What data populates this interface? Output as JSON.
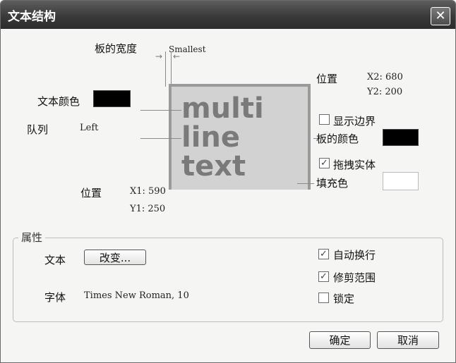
{
  "window": {
    "title": "文本结构",
    "close_glyph": "✕"
  },
  "top": {
    "panel_width_label": "板的宽度",
    "smallest": "Smallest",
    "text_color_label": "文本颜色",
    "align_label": "队列",
    "align_value": "Left",
    "pos1_label": "位置",
    "x1": "X1:  590",
    "y1": "Y1:  250",
    "pos2_label": "位置",
    "x2": "X2:  680",
    "y2": "Y2:  200",
    "show_border_label": "显示边界",
    "panel_color_label": "板的颜色",
    "drag_label": "拖拽实体",
    "fill_color_label": "填充色"
  },
  "preview": {
    "line1": "multi",
    "line2": "line",
    "line3": "text"
  },
  "checkboxes": {
    "show_border": false,
    "drag_solid": true,
    "auto_wrap": true,
    "trim_range": true,
    "lock": false
  },
  "props": {
    "group_label": "属性",
    "text_label": "文本",
    "change_button": "改变...",
    "font_label": "字体",
    "font_value": "Times New Roman, 10",
    "auto_wrap_label": "自动换行",
    "trim_label": "修剪范围",
    "lock_label": "锁定"
  },
  "footer": {
    "ok": "确定",
    "cancel": "取消"
  },
  "colors": {
    "text_color": "#000000",
    "panel_color": "#000000",
    "fill_color": "#ffffff",
    "preview_bg": "#d2d2d2"
  },
  "check_glyph": "✓"
}
